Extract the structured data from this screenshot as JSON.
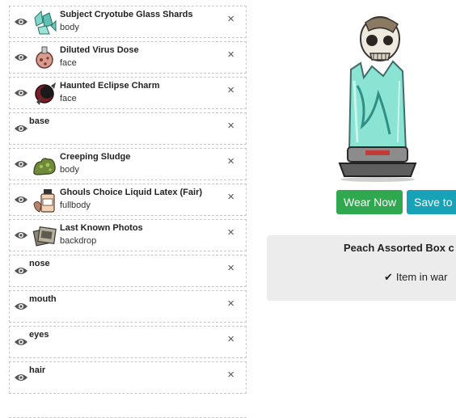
{
  "layers": [
    {
      "name": "Subject Cryotube Glass Shards",
      "category": "body",
      "thumb": "glass-shards-icon"
    },
    {
      "name": "Diluted Virus Dose",
      "category": "face",
      "thumb": "virus-dose-icon"
    },
    {
      "name": "Haunted Eclipse Charm",
      "category": "face",
      "thumb": "eclipse-charm-icon"
    },
    {
      "name": "base",
      "category": "",
      "thumb": ""
    },
    {
      "name": "Creeping Sludge",
      "category": "body",
      "thumb": "sludge-icon"
    },
    {
      "name": "Ghouls Choice Liquid Latex (Fair)",
      "category": "fullbody",
      "thumb": "latex-bottle-icon"
    },
    {
      "name": "Last Known Photos",
      "category": "backdrop",
      "thumb": "photos-icon"
    },
    {
      "name": "nose",
      "category": "",
      "thumb": ""
    },
    {
      "name": "mouth",
      "category": "",
      "thumb": ""
    },
    {
      "name": "eyes",
      "category": "",
      "thumb": ""
    },
    {
      "name": "hair",
      "category": "",
      "thumb": ""
    }
  ],
  "remove_glyph": "×",
  "actions": {
    "wear_label": "Wear Now",
    "save_label": "Save to S"
  },
  "item_panel": {
    "title": "Peach Assorted Box c",
    "status": "Item in war",
    "status_icon": "check-icon"
  },
  "colors": {
    "wear_button": "#2fa84f",
    "save_button": "#17a2b8",
    "panel_bg": "#ececec"
  }
}
